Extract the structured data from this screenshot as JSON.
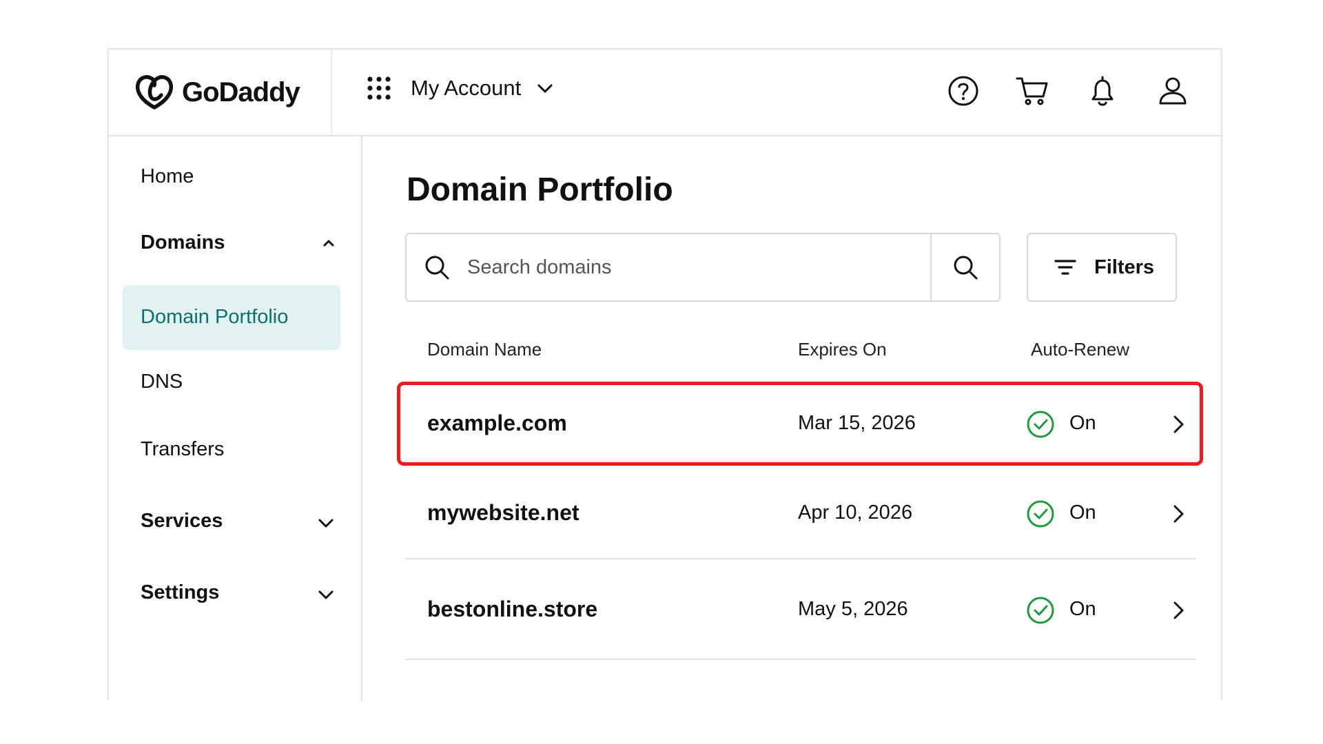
{
  "header": {
    "brand": "GoDaddy",
    "account_label": "My Account",
    "icons": [
      "help-icon",
      "cart-icon",
      "bell-icon",
      "user-icon"
    ]
  },
  "sidebar": {
    "items": [
      {
        "label": "Home"
      },
      {
        "label": "Domains",
        "expanded": true
      },
      {
        "label": "Domain Portfolio",
        "active": true
      },
      {
        "label": "DNS"
      },
      {
        "label": "Transfers"
      },
      {
        "label": "Services",
        "expanded": false
      },
      {
        "label": "Settings",
        "expanded": false
      }
    ]
  },
  "main": {
    "title": "Domain Portfolio",
    "search": {
      "placeholder": "Search domains",
      "value": ""
    },
    "filters_label": "Filters",
    "columns": [
      "Domain Name",
      "Expires On",
      "Auto-Renew"
    ],
    "rows": [
      {
        "domain": "example.com",
        "expires": "Mar 15, 2026",
        "auto_renew": "On",
        "highlighted": true
      },
      {
        "domain": "mywebsite.net",
        "expires": "Apr 10, 2026",
        "auto_renew": "On"
      },
      {
        "domain": "bestonline.store",
        "expires": "May 5, 2026",
        "auto_renew": "On"
      }
    ]
  },
  "colors": {
    "accent_teal": "#0b7070",
    "active_bg": "#e1f2f1",
    "success_green": "#1e9a3a",
    "highlight_red": "#ee1c1c"
  }
}
